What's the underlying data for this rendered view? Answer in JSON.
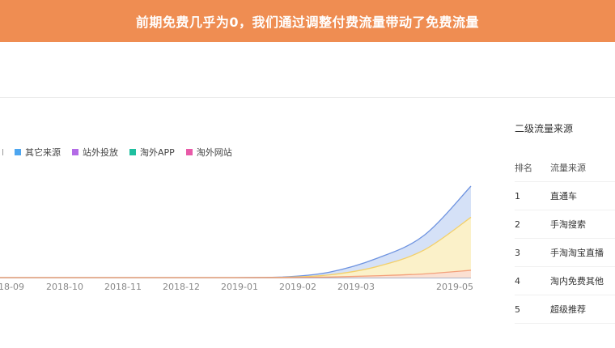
{
  "banner": {
    "title": "前期免费几乎为0，我们通过调整付费流量带动了免费流量"
  },
  "legend": {
    "items": [
      {
        "label": "其它来源",
        "color": "#4da6f0"
      },
      {
        "label": "站外投放",
        "color": "#b36be6"
      },
      {
        "label": "淘外APP",
        "color": "#1fbf9f"
      },
      {
        "label": "淘外网站",
        "color": "#e85aa8"
      }
    ]
  },
  "chart_data": {
    "type": "area",
    "x_tick_labels": [
      "18-09",
      "2018-10",
      "2018-11",
      "2018-12",
      "2019-01",
      "2019-02",
      "2019-03",
      "2019-05"
    ],
    "series": [
      {
        "color": "#6e93e0",
        "fill": "#d5e1f7",
        "values": [
          0,
          0,
          0,
          0,
          0,
          0,
          0.6,
          6,
          21,
          46,
          100
        ]
      },
      {
        "color": "#f3d06a",
        "fill": "#fbf1c9",
        "values": [
          0,
          0,
          0,
          0,
          0,
          0,
          0.3,
          3,
          12,
          30,
          66
        ]
      },
      {
        "color": "#f3a07a",
        "fill": "#fbe0d2",
        "values": [
          0,
          0,
          0,
          0,
          0,
          0,
          0.05,
          0.6,
          2,
          4,
          8
        ]
      }
    ],
    "xlim": [
      0,
      10
    ],
    "ylim": [
      0,
      100
    ]
  },
  "side_panel": {
    "title": "二级流量来源",
    "headers": [
      "排名",
      "流量来源"
    ],
    "rows": [
      {
        "rank": "1",
        "source": "直通车"
      },
      {
        "rank": "2",
        "source": "手淘搜索"
      },
      {
        "rank": "3",
        "source": "手淘淘宝直播"
      },
      {
        "rank": "4",
        "source": "淘内免费其他"
      },
      {
        "rank": "5",
        "source": "超级推荐"
      }
    ]
  }
}
